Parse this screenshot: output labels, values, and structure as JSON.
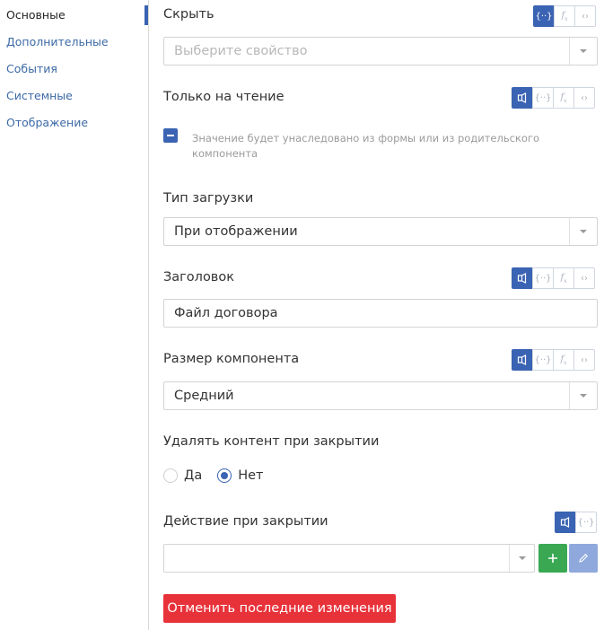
{
  "sidebar": {
    "items": [
      {
        "label": "Основные",
        "active": true
      },
      {
        "label": "Дополнительные",
        "active": false
      },
      {
        "label": "События",
        "active": false
      },
      {
        "label": "Системные",
        "active": false
      },
      {
        "label": "Отображение",
        "active": false
      }
    ]
  },
  "mode_icons": {
    "static": "speaker-panel-icon",
    "binding": "curly-braces-icon",
    "formula": "fx-icon",
    "code": "code-brackets-icon"
  },
  "colors": {
    "accent": "#3b63b3",
    "success": "#3aa853",
    "danger": "#e8323a",
    "edit": "#8fa9dc"
  },
  "fields": {
    "hide": {
      "label": "Скрыть",
      "placeholder": "Выберите свойство",
      "active_mode": "binding"
    },
    "readonly": {
      "label": "Только на чтение",
      "active_mode": "static",
      "checkbox_state": "indeterminate",
      "hint": "Значение будет унаследовано из формы или из родительского компонента"
    },
    "load_type": {
      "label": "Тип загрузки",
      "value": "При отображении"
    },
    "title": {
      "label": "Заголовок",
      "active_mode": "static",
      "value": "Файл договора"
    },
    "size": {
      "label": "Размер компонента",
      "active_mode": "static",
      "value": "Средний"
    },
    "delete_on_close": {
      "label": "Удалять контент при закрытии",
      "options": [
        {
          "label": "Да",
          "checked": false
        },
        {
          "label": "Нет",
          "checked": true
        }
      ]
    },
    "close_action": {
      "label": "Действие при закрытии",
      "active_mode": "static",
      "value": ""
    }
  },
  "actions": {
    "add_icon": "plus-icon",
    "edit_icon": "pencil-icon",
    "reset_label": "Отменить последние изменения"
  }
}
